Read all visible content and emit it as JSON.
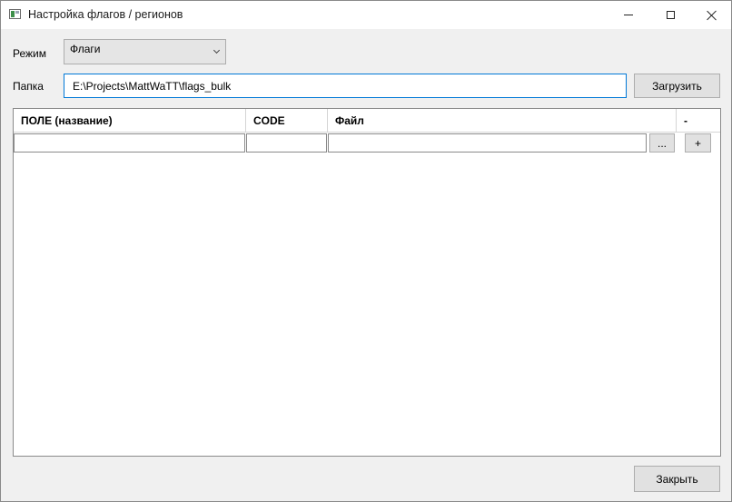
{
  "window": {
    "title": "Настройка флагов / регионов",
    "controls": {
      "minimize_icon": "minimize-icon",
      "maximize_icon": "maximize-icon",
      "close_icon": "close-icon"
    }
  },
  "mode": {
    "label": "Режим",
    "selected": "Флаги"
  },
  "folder": {
    "label": "Папка",
    "value": "E:\\Projects\\MattWaTT\\flags_bulk",
    "load_label": "Загрузить"
  },
  "grid": {
    "columns": [
      "ПОЛЕ (название)",
      "CODE",
      "Файл",
      "-"
    ],
    "new_row": {
      "field": "",
      "code": "",
      "file": "",
      "browse_label": "...",
      "add_label": "+"
    }
  },
  "footer": {
    "close_label": "Закрыть"
  }
}
